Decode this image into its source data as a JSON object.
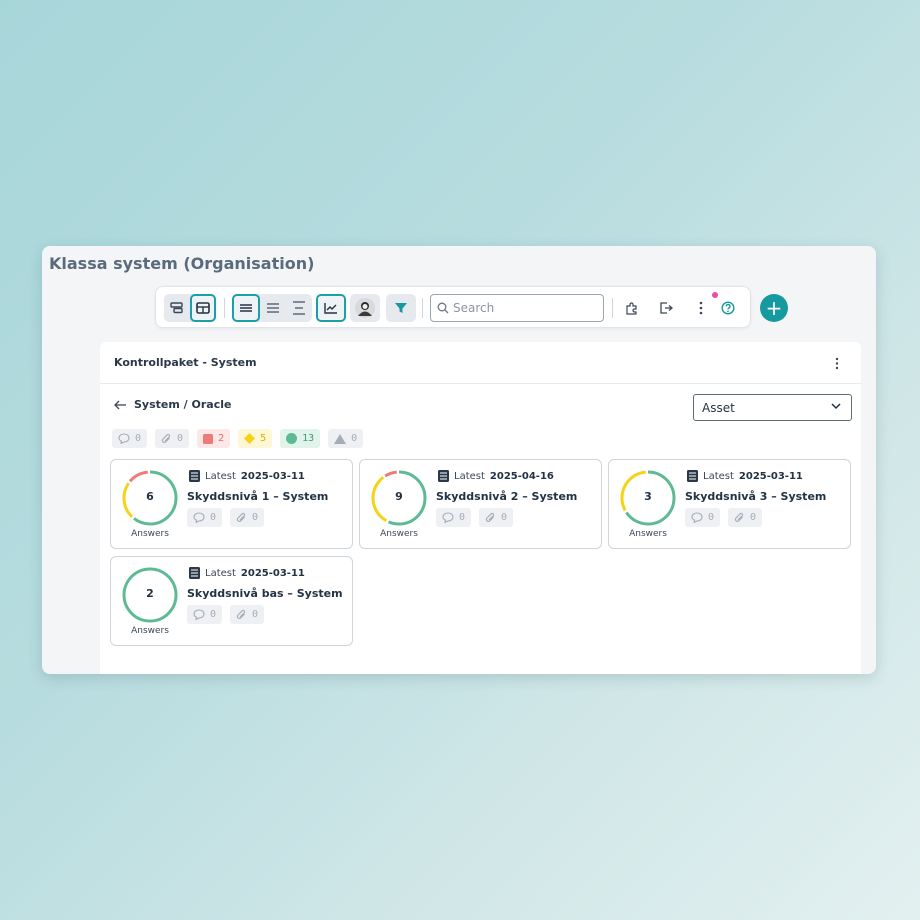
{
  "app": {
    "title": "Klassa system (Organisation)"
  },
  "toolbar": {
    "search_placeholder": "Search",
    "icons": [
      "view-card-icon",
      "view-table-icon",
      "density-compact-icon",
      "density-normal-icon",
      "density-loose-icon",
      "chart-icon",
      "avatar",
      "filter-icon",
      "plugin-icon",
      "export-icon",
      "more-icon",
      "help-icon"
    ],
    "accent_color": "#1aa0a6",
    "notification_dot_color": "#ef4aa6",
    "add_label": "+"
  },
  "panel": {
    "title": "Kontrollpaket - System",
    "breadcrumb": "System / Oracle",
    "select_value": "Asset",
    "stats": {
      "comments": "0",
      "attachments": "0",
      "red": "2",
      "yellow": "5",
      "green": "13",
      "triangle": "0"
    }
  },
  "cards": [
    {
      "count": "6",
      "answers_label": "Answers",
      "latest_label": "Latest",
      "latest_date": "2025-03-11",
      "title": "Skyddsnivå 1 – System",
      "comments": "0",
      "attachments": "0",
      "ring": {
        "green": 0.62,
        "yellow": 0.24,
        "red": 0.14
      }
    },
    {
      "count": "9",
      "answers_label": "Answers",
      "latest_label": "Latest",
      "latest_date": "2025-04-16",
      "title": "Skyddsnivå 2 – System",
      "comments": "0",
      "attachments": "0",
      "ring": {
        "green": 0.58,
        "yellow": 0.33,
        "red": 0.09
      }
    },
    {
      "count": "3",
      "answers_label": "Answers",
      "latest_label": "Latest",
      "latest_date": "2025-03-11",
      "title": "Skyddsnivå 3 – System",
      "comments": "0",
      "attachments": "0",
      "ring": {
        "green": 0.67,
        "yellow": 0.33,
        "red": 0
      }
    },
    {
      "count": "2",
      "answers_label": "Answers",
      "latest_label": "Latest",
      "latest_date": "2025-03-11",
      "title": "Skyddsnivå bas – System",
      "comments": "0",
      "attachments": "0",
      "ring": {
        "green": 1.0,
        "yellow": 0,
        "red": 0
      }
    }
  ],
  "colors": {
    "green": "#5dbb94",
    "yellow": "#f4d318",
    "red": "#ef7b78",
    "brand": "#159aa0"
  }
}
